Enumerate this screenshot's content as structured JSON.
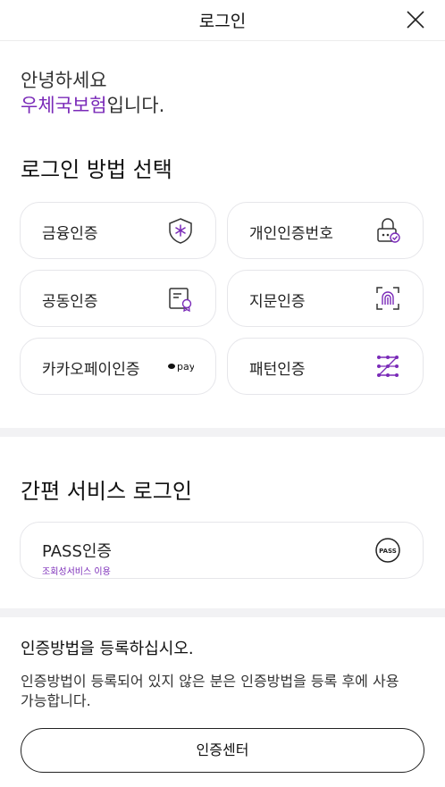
{
  "header": {
    "title": "로그인",
    "close_icon": "close-icon"
  },
  "greeting": {
    "line1": "안녕하세요",
    "brand": "우체국보험",
    "line2_suffix": "입니다."
  },
  "login_methods": {
    "title": "로그인 방법 선택",
    "items": [
      {
        "label": "금융인증",
        "icon": "shield-icon"
      },
      {
        "label": "개인인증번호",
        "icon": "lock-check-icon"
      },
      {
        "label": "공동인증",
        "icon": "certificate-icon"
      },
      {
        "label": "지문인증",
        "icon": "fingerprint-icon"
      },
      {
        "label": "카카오페이인증",
        "icon": "kakaopay-icon",
        "icon_text": "pay"
      },
      {
        "label": "패턴인증",
        "icon": "pattern-icon"
      }
    ]
  },
  "simple_login": {
    "title": "간편 서비스 로그인",
    "pass": {
      "label": "PASS인증",
      "sub": "조회성서비스 이용",
      "icon_text": "PASS"
    }
  },
  "notice": {
    "title": "인증방법을 등록하십시오.",
    "body": "인증방법이 등록되어 있지 않은 분은 인증방법을 등록 후에 사용 가능합니다.",
    "button": "인증센터"
  },
  "colors": {
    "brand": "#7a2ab8",
    "border": "#e6e6ea",
    "divider": "#f2f2f4"
  }
}
